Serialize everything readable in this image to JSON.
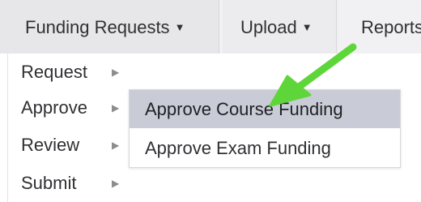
{
  "menubar": {
    "items": [
      {
        "label": "Funding Requests",
        "caret": "▼"
      },
      {
        "label": "Upload",
        "caret": "▼"
      },
      {
        "label": "Reports"
      }
    ]
  },
  "dropdown": {
    "items": [
      {
        "label": "Request",
        "arrow": "▶"
      },
      {
        "label": "Approve",
        "arrow": "▶"
      },
      {
        "label": "Review",
        "arrow": "▶"
      },
      {
        "label": "Submit",
        "arrow": "▶"
      }
    ]
  },
  "submenu": {
    "items": [
      {
        "label": "Approve Course Funding",
        "highlighted": true
      },
      {
        "label": "Approve Exam Funding",
        "highlighted": false
      }
    ]
  },
  "colors": {
    "highlight": "#c9ccd6",
    "annotation_arrow": "#5ed63a",
    "menubar_bg": "#f1f1f3"
  },
  "icons": {
    "menu_caret": "caret-down-icon",
    "submenu_arrow": "caret-right-icon",
    "annotation": "green-arrow-icon"
  }
}
